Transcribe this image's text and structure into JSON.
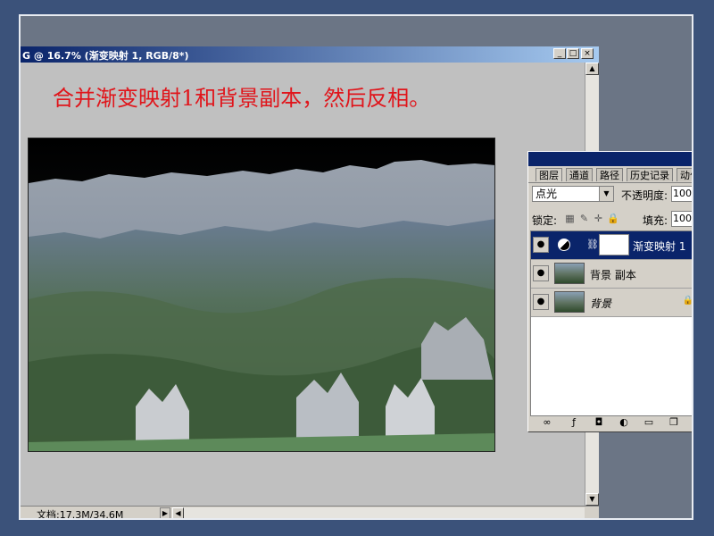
{
  "window": {
    "title": "G @ 16.7% (渐变映射 1, RGB/8*)",
    "min_label": "_",
    "max_label": "□",
    "close_label": "×"
  },
  "instruction": "合并渐变映射1和背景副本，然后反相。",
  "statusbar": {
    "doc_size": "文档:17.3M/34.6M",
    "arrow": "▶",
    "scroll_left": "◀"
  },
  "scrollbar": {
    "up": "▲",
    "down": "▼"
  },
  "layers_panel": {
    "tabs": [
      "图层",
      "通道",
      "路径",
      "历史记录",
      "动作"
    ],
    "blend_mode": "点光",
    "opacity_label": "不透明度:",
    "opacity_value": "100",
    "lock_label": "锁定:",
    "fill_label": "填充:",
    "fill_value": "100",
    "layers": [
      {
        "name": "渐变映射 1",
        "selected": true,
        "visible": true
      },
      {
        "name": "背景 副本",
        "selected": false,
        "visible": true
      },
      {
        "name": "背景",
        "selected": false,
        "visible": true,
        "locked": true
      }
    ],
    "footer_icons": [
      "link-icon",
      "layer-style-icon",
      "mask-icon",
      "adjustment-icon",
      "folder-icon",
      "new-layer-icon"
    ]
  },
  "colors": {
    "instruction_text": "#e0151b",
    "selected_layer": "#0a246a",
    "slide_background": "#3b527a"
  }
}
